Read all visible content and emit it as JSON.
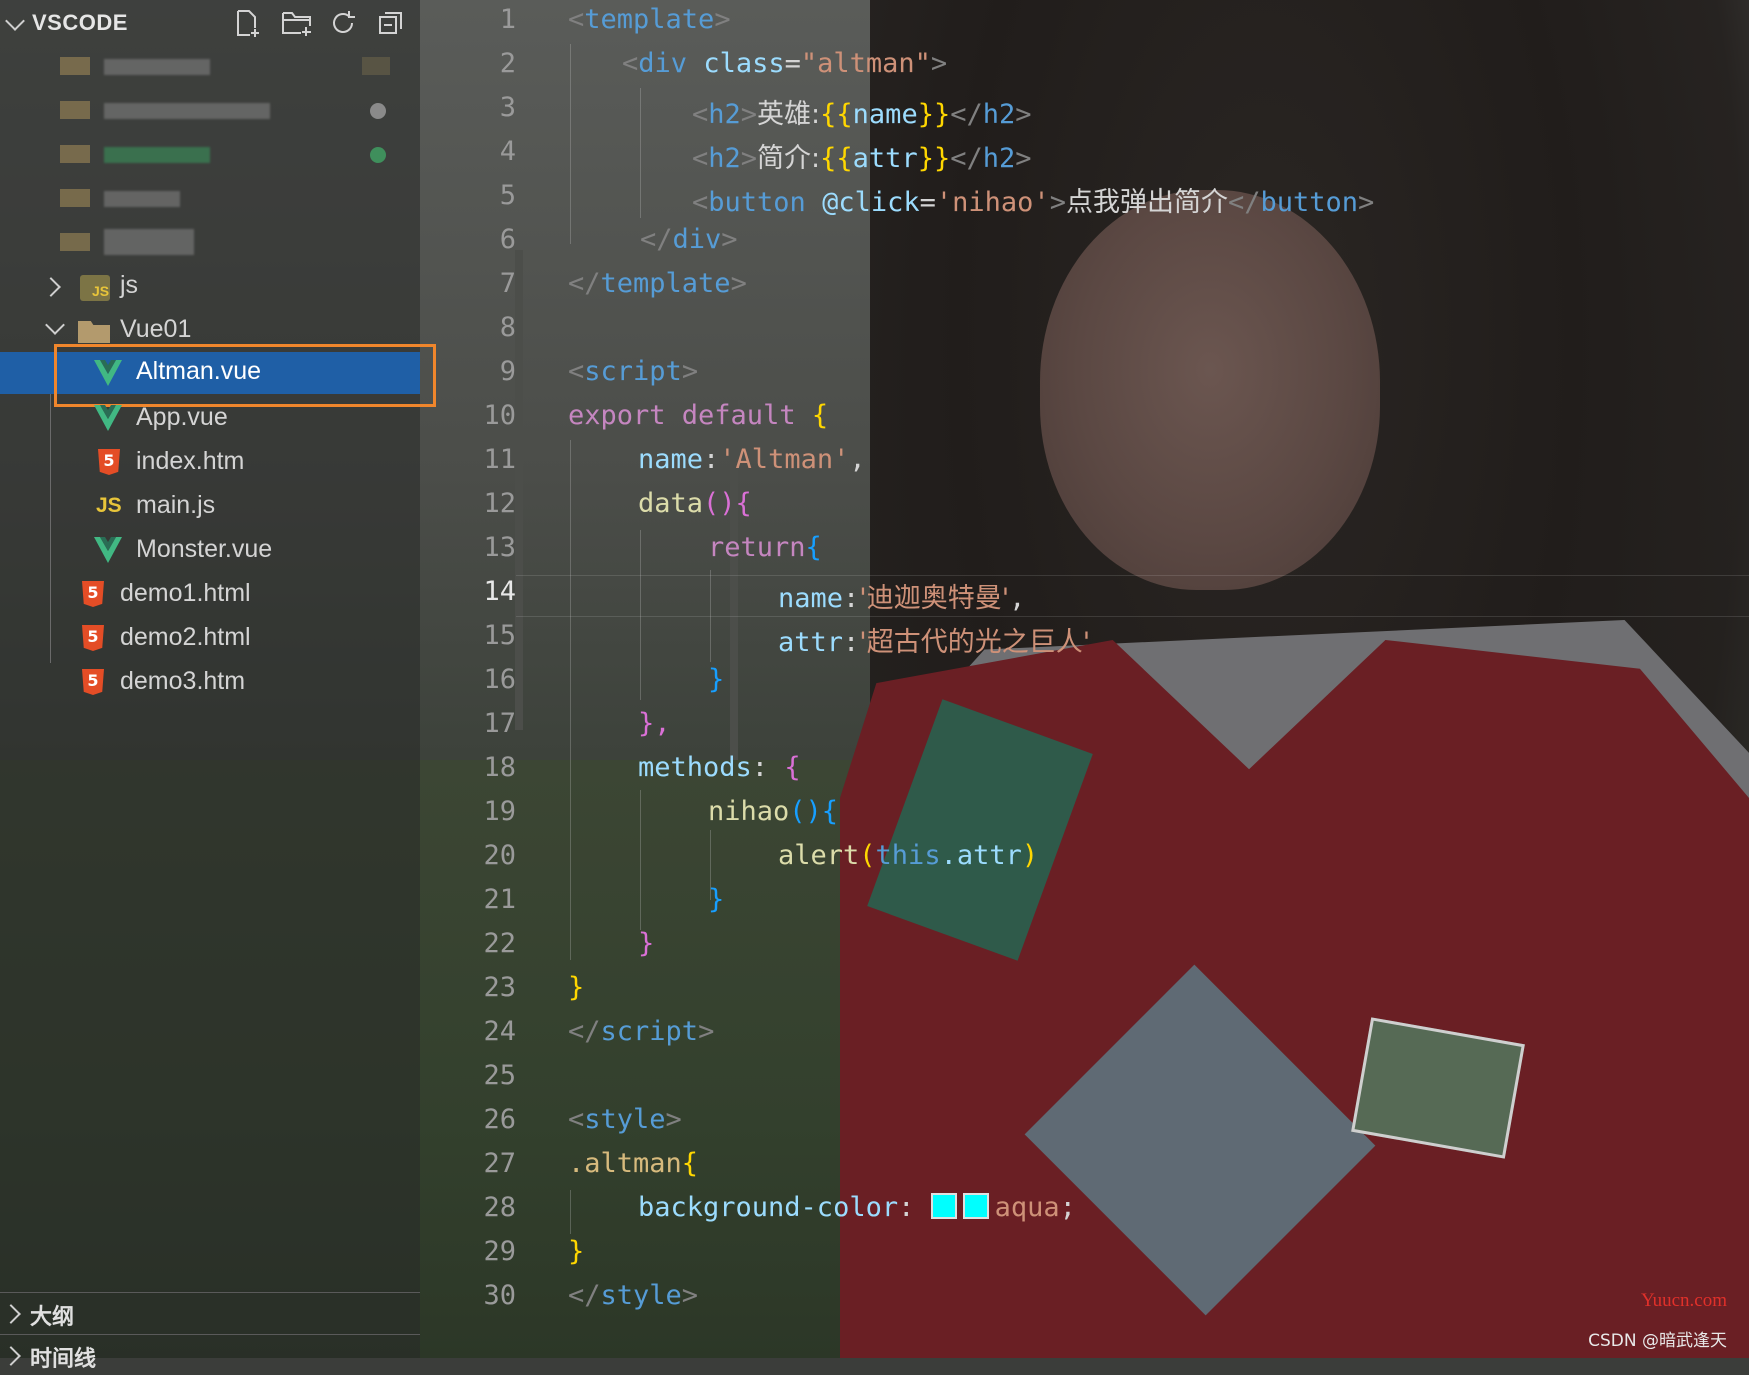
{
  "explorer": {
    "title": "VSCODE",
    "actions": [
      "new-file-icon",
      "new-folder-icon",
      "refresh-icon",
      "collapse-all-icon"
    ],
    "tree": [
      {
        "label": "js",
        "type": "folder-closed",
        "icon": "js-folder-icon"
      },
      {
        "label": "Vue01",
        "type": "folder-open",
        "icon": "folder-open-icon"
      },
      {
        "label": "Altman.vue",
        "type": "file",
        "icon": "vue-icon",
        "selected": true
      },
      {
        "label": "App.vue",
        "type": "file",
        "icon": "vue-icon"
      },
      {
        "label": "index.htm",
        "type": "file",
        "icon": "html5-icon"
      },
      {
        "label": "main.js",
        "type": "file",
        "icon": "js-icon"
      },
      {
        "label": "Monster.vue",
        "type": "file",
        "icon": "vue-icon"
      },
      {
        "label": "demo1.html",
        "type": "file",
        "icon": "html5-icon"
      },
      {
        "label": "demo2.html",
        "type": "file",
        "icon": "html5-icon"
      },
      {
        "label": "demo3.htm",
        "type": "file",
        "icon": "html5-icon"
      }
    ],
    "outline_label": "大纲",
    "timeline_label": "时间线"
  },
  "editor": {
    "active_line": "14",
    "line_numbers": [
      "1",
      "2",
      "3",
      "4",
      "5",
      "6",
      "7",
      "8",
      "9",
      "10",
      "11",
      "12",
      "13",
      "14",
      "15",
      "16",
      "17",
      "18",
      "19",
      "20",
      "21",
      "22",
      "23",
      "24",
      "25",
      "26",
      "27",
      "28",
      "29",
      "30"
    ],
    "code": {
      "l1_open": "<",
      "l1_tag": "template",
      "l1_close": ">",
      "l2_tag": "div",
      "l2_attr": "class",
      "l2_eq": "=",
      "l2_val": "\"altman\"",
      "l3_tag": "h2",
      "l3_text": "英雄:",
      "l3_open": "{{",
      "l3_var": "name",
      "l3_close": "}}",
      "l4_tag": "h2",
      "l4_text": "简介:",
      "l4_open": "{{",
      "l4_var": "attr",
      "l4_close": "}}",
      "l5_tag": "button",
      "l5_attr": "@click",
      "l5_eq": "=",
      "l5_val": "'nihao'",
      "l5_text": "点我弹出简介",
      "l6_tag": "div",
      "l7_tag": "template",
      "l9_tag": "script",
      "l10_kw": "export default",
      "l10_brace": "{",
      "l11_key": "name",
      "l11_val": "'Altman'",
      "l11_comma": ",",
      "l12_fn": "data",
      "l12_paren": "()",
      "l12_brace": "{",
      "l13_kw": "return",
      "l13_brace": "{",
      "l14_key": "name",
      "l14_val": "'迪迦奥特曼'",
      "l14_comma": ",",
      "l15_key": "attr",
      "l15_val": "'超古代的光之巨人'",
      "l16_brace": "}",
      "l17_brace": "},",
      "l18_key": "methods",
      "l18_colon": ":",
      "l18_brace": "{",
      "l19_fn": "nihao",
      "l19_paren": "()",
      "l19_brace": "{",
      "l20_fn": "alert",
      "l20_popen": "(",
      "l20_this": "this",
      "l20_prop": ".attr",
      "l20_pclose": ")",
      "l21_brace": "}",
      "l22_brace": "}",
      "l23_brace": "}",
      "l24_tag": "script",
      "l26_tag": "style",
      "l27_sel": ".altman",
      "l27_brace": "{",
      "l28_prop": "background-color",
      "l28_colon": ":",
      "l28_val": "aqua",
      "l28_semi": ";",
      "l29_brace": "}",
      "l30_tag": "style"
    }
  },
  "watermark": "Yuucn.com",
  "credit": "CSDN @暗武逢天",
  "colors": {
    "selection": "#1f5fa6",
    "highlight_outline": "#f0862c",
    "swatch": "#00ffff"
  }
}
